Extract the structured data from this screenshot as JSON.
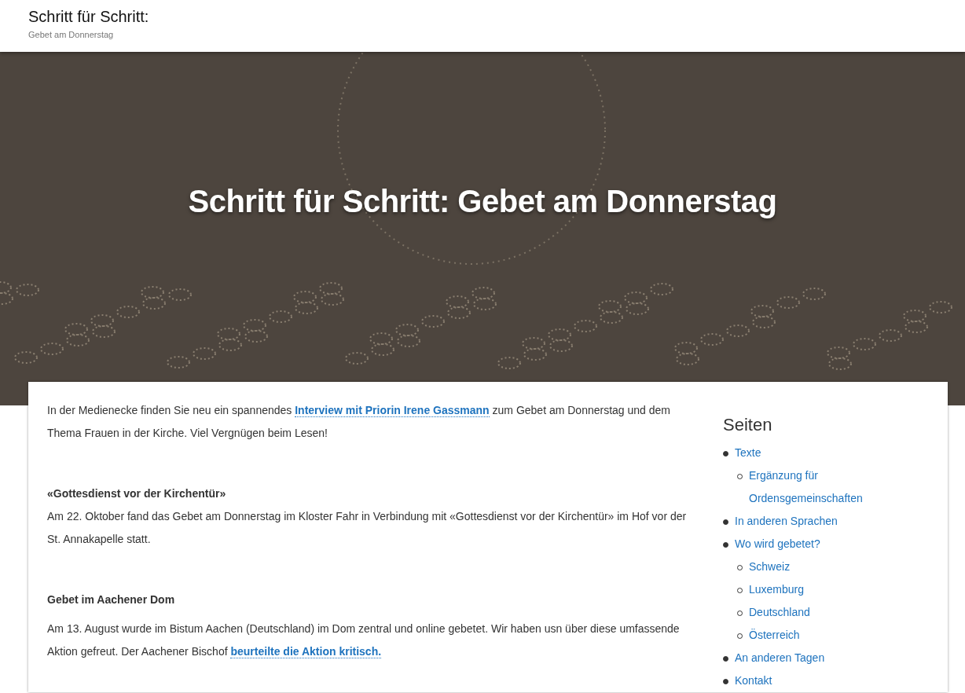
{
  "header": {
    "title": "Schritt für Schritt:",
    "tagline": "Gebet am Donnerstag"
  },
  "hero": {
    "title": "Schritt für Schritt: Gebet am Donnerstag"
  },
  "article": [
    {
      "kind": "paragraph",
      "segments": [
        {
          "kind": "text",
          "text": "In der Medienecke finden Sie neu ein spannendes "
        },
        {
          "kind": "link",
          "text": "Interview mit Priorin Irene Gassmann"
        },
        {
          "kind": "text",
          "text": " zum Gebet am Donnerstag und dem Thema Frauen in der Kirche. Viel Vergnügen beim Lesen!"
        }
      ]
    },
    {
      "kind": "heading",
      "text": "«Gottesdienst vor der Kirchentür»"
    },
    {
      "kind": "paragraph",
      "segments": [
        {
          "kind": "text",
          "text": "Am 22. Oktober fand das Gebet am Donnerstag im Kloster Fahr in Verbindung mit «Gottesdienst vor der Kirchentür» im Hof vor der St. Annakapelle statt."
        }
      ]
    },
    {
      "kind": "heading",
      "text": "Gebet im Aachener Dom"
    },
    {
      "kind": "paragraph",
      "segments": [
        {
          "kind": "text",
          "text": "Am 13. August wurde im Bistum Aachen (Deutschland) im Dom zentral und online gebetet. Wir haben usn über diese umfassende Aktion gefreut. Der Aachener Bischof "
        },
        {
          "kind": "link",
          "text": "beurteilte die Aktion kritisch."
        }
      ]
    }
  ],
  "sidebar": {
    "title": "Seiten",
    "items": [
      {
        "label": "Texte",
        "children": [
          {
            "label": "Ergänzung für Ordensgemeinschaften"
          }
        ]
      },
      {
        "label": "In anderen Sprachen"
      },
      {
        "label": "Wo wird gebetet?",
        "children": [
          {
            "label": "Schweiz"
          },
          {
            "label": "Luxemburg"
          },
          {
            "label": "Deutschland"
          },
          {
            "label": "Österreich"
          }
        ]
      },
      {
        "label": "An anderen Tagen"
      },
      {
        "label": "Kontakt"
      }
    ]
  }
}
